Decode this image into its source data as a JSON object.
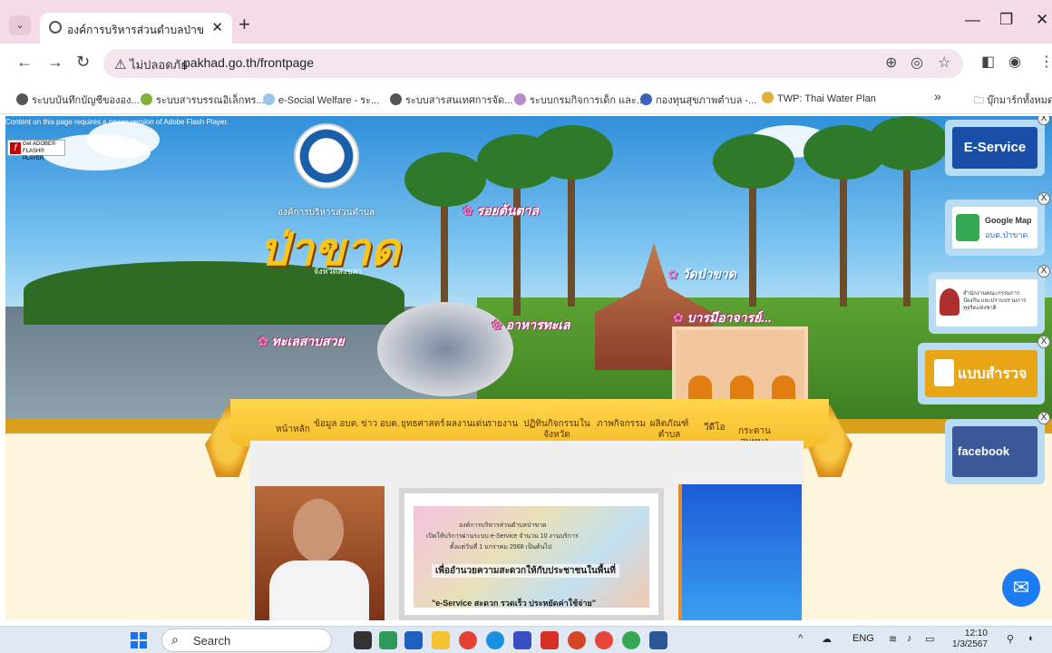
{
  "browser": {
    "tab_title": "องค์การบริหารส่วนตำบลป่าขาด อ.สิงหนคร",
    "address_warning": "ไม่ปลอดภัย",
    "url": "pakhad.go.th/frontpage",
    "bookmarks": [
      "ระบบบันทึกบัญชีขององ...",
      "ระบบสารบรรณอิเล็กทร...",
      "e-Social Welfare - ระ...",
      "ระบบสารสนเทศการจัด...",
      "ระบบกรมกิจการเด็ก และ...",
      "กองทุนสุขภาพตำบล -...",
      "TWP: Thai Water Plan"
    ],
    "bookmarks_overflow": "»",
    "all_bookmarks": "บุ๊กมาร์กทั้งหมด"
  },
  "page": {
    "flash_message": "Content on this page requires a newer version of Adobe Flash Player.",
    "flash_badge": "Get ADOBE® FLASH® PLAYER",
    "org_name": "องค์การบริหารส่วนตำบล",
    "org_title": "ป่าขาด",
    "province": "จังหวัดสงขลา",
    "labels": {
      "palm": "รอยต้นตาล",
      "temple": "วัดป่าขาด",
      "sea": "ทะเลสาบสวย",
      "seafood": "อาหารทะเล",
      "monks": "บารมีอาจารย์..."
    },
    "nav_items": [
      "หน้าหลัก",
      "ข้อมูล อบต.",
      "ข่าว อบต.",
      "ยุทธศาสตร์",
      "ผลงานเด่น",
      "รายงาน",
      "ปฏิทินกิจกรรมใน จังหวัด",
      "ภาพกิจกรรม",
      "ผลิตภัณฑ์ ตำบล",
      "วีดีโอ",
      "กระดาน สนทนา"
    ],
    "announcement": {
      "line1": "องค์การบริหารส่วนตำบลป่าขาด",
      "line2": "เปิดให้บริการผ่านระบบ e-Service จำนวน 10 งานบริการ",
      "line3": "ตั้งแต่วันที่ 1 มกราคม 2568 เป็นต้นไป",
      "big": "เพื่ออำนวยความสะดวกให้กับประชาชนในพื้นที่",
      "bottom": "\"e-Service สะดวก รวดเร็ว ประหยัดค่าใช้จ่าย\""
    },
    "services": {
      "eservice": "E-Service",
      "google_map_title": "Google Map",
      "google_map_sub": "อบต.ป่าขาด",
      "nacc": "สำนักงานคณะกรรมการป้องกัน และปราบปรามการทุจริตแห่งชาติ",
      "survey": "แบบสำรวจ",
      "facebook": "facebook",
      "close": "X"
    }
  },
  "taskbar": {
    "search_placeholder": "Search",
    "lang": "ENG",
    "time": "12:10",
    "date": "1/3/2567"
  },
  "colors": {
    "tab_strip": "#f6dbe9",
    "nav_gold": "#f2b51f",
    "eservice_blue": "#1a4fa8",
    "survey_gold": "#e8a515",
    "facebook_blue": "#3b5998"
  }
}
